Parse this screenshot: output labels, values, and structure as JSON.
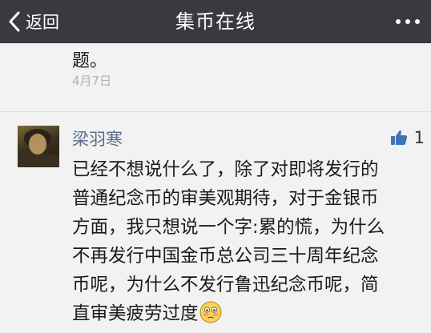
{
  "nav": {
    "back_label": "返回",
    "title": "集币在线"
  },
  "previous_comment": {
    "tail_text": "题。",
    "date": "4月7日"
  },
  "comment": {
    "username": "梁羽寒",
    "like_count": "1",
    "lines": [
      "已经不想说什么了，除了对即将发行的",
      "普通纪念币的审美观期待，对于金银币",
      "方面，我只想说一个字:累的慌，为什么",
      "不再发行中国金币总公司三十周年纪念",
      "币呢，为什么不发行鲁迅纪念币呢，简",
      "直审美疲劳过度"
    ],
    "emoji_icon": "flushed-face-emoji"
  },
  "colors": {
    "nav_bg": "#393a3f",
    "username": "#5b6b8c",
    "like_icon": "#3e73b8"
  }
}
